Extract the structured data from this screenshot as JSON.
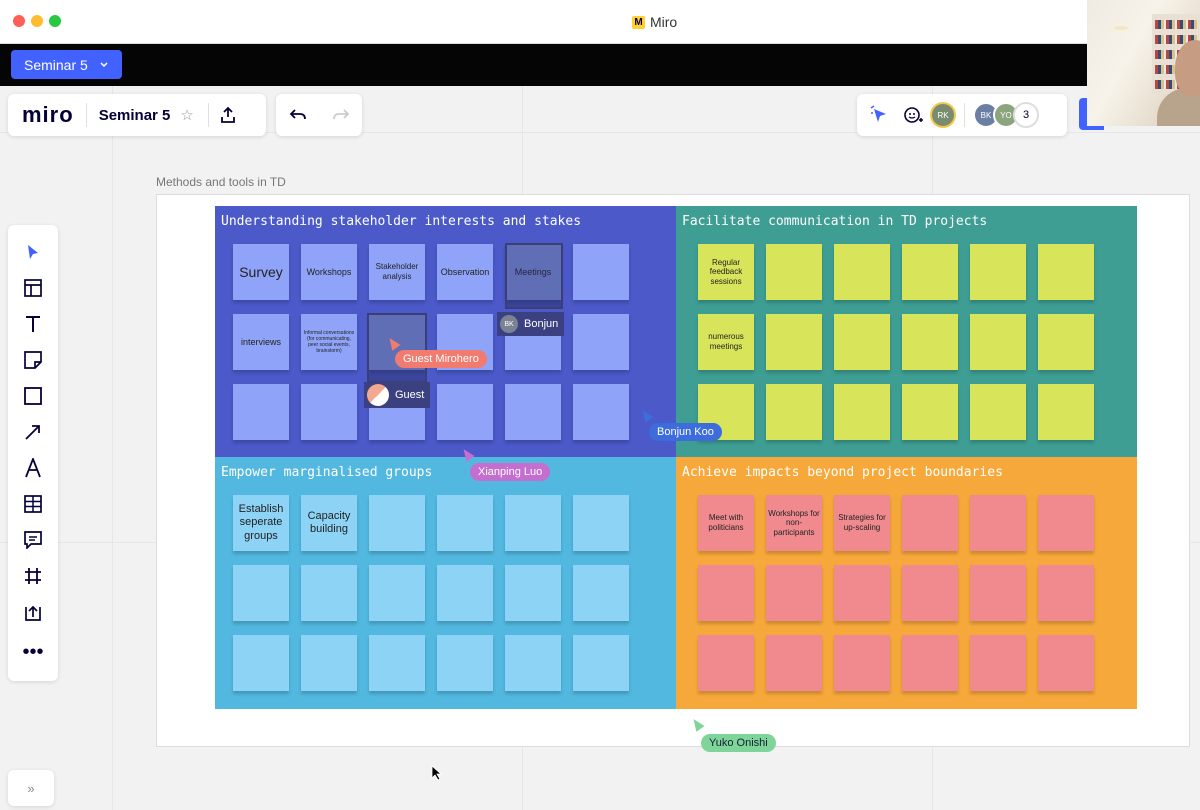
{
  "window": {
    "title": "Miro"
  },
  "board_tab": {
    "label": "Seminar 5",
    "chevron": "chevron-down-icon"
  },
  "header": {
    "logo": "miro",
    "board_name": "Seminar 5",
    "star_icon": "☆",
    "share_icon": "upload-icon"
  },
  "undo": {
    "undo_icon": "undo-icon",
    "redo_icon": "redo-icon"
  },
  "collab": {
    "avatars": [
      {
        "initials": "RK",
        "color": "#7a8c6f"
      },
      {
        "initials": "BK",
        "color": "#6b7fa5"
      },
      {
        "initials": "YO",
        "color": "#8ca57f"
      }
    ],
    "count": "3"
  },
  "toolbar": {
    "tools": [
      "select-tool",
      "templates-tool",
      "text-tool",
      "sticky-note-tool",
      "shape-tool",
      "connection-line-tool",
      "pen-tool",
      "table-tool",
      "comment-tool",
      "frame-tool",
      "upload-tool",
      "more-tools"
    ]
  },
  "frame": {
    "label": "Methods and tools in TD"
  },
  "quadrants": [
    {
      "title": "Understanding stakeholder interests and stakes",
      "bg": "#4b59c9",
      "note_color": "#8fa4f8",
      "notes": [
        "Survey",
        "Workshops",
        "Stakeholder analysis",
        "Observation",
        "Meetings",
        "",
        "interviews",
        "Informal conversations (for communicating, peer social events, brainstorm)",
        "",
        "",
        "",
        "",
        "",
        "",
        "",
        "",
        "",
        ""
      ]
    },
    {
      "title": "Facilitate communication in TD projects",
      "bg": "#3e9e93",
      "note_color": "#d8e55b",
      "notes": [
        "Regular feedback sessions",
        "",
        "",
        "",
        "",
        "",
        "numerous meetings",
        "",
        "",
        "",
        "",
        "",
        "",
        "",
        "",
        "",
        "",
        ""
      ]
    },
    {
      "title": "Empower marginalised groups",
      "bg": "#52b8df",
      "note_color": "#8dd3f6",
      "notes": [
        "Establish seperate groups",
        "Capacity building",
        "",
        "",
        "",
        "",
        "",
        "",
        "",
        "",
        "",
        "",
        "",
        "",
        "",
        "",
        "",
        ""
      ]
    },
    {
      "title": "Achieve impacts beyond project boundaries",
      "bg": "#f7a83a",
      "note_color": "#f08a8f",
      "notes": [
        "Meet with politicians",
        "Workshops for non-participants",
        "Strategies for up-scaling",
        "",
        "",
        "",
        "",
        "",
        "",
        "",
        "",
        "",
        "",
        "",
        "",
        "",
        "",
        ""
      ]
    }
  ],
  "cursors": [
    {
      "name": "Guest Mirohero",
      "color": "#f07b6e"
    },
    {
      "name": "Bonjun Koo",
      "color": "#3d6cdc"
    },
    {
      "name": "Xianping Luo",
      "color": "#c46fd0"
    },
    {
      "name": "Yuko Onishi",
      "color": "#7fd49a"
    }
  ],
  "selections": [
    {
      "name": "Bonjun",
      "initials": "BK"
    },
    {
      "name": "Guest",
      "initials": ""
    }
  ]
}
